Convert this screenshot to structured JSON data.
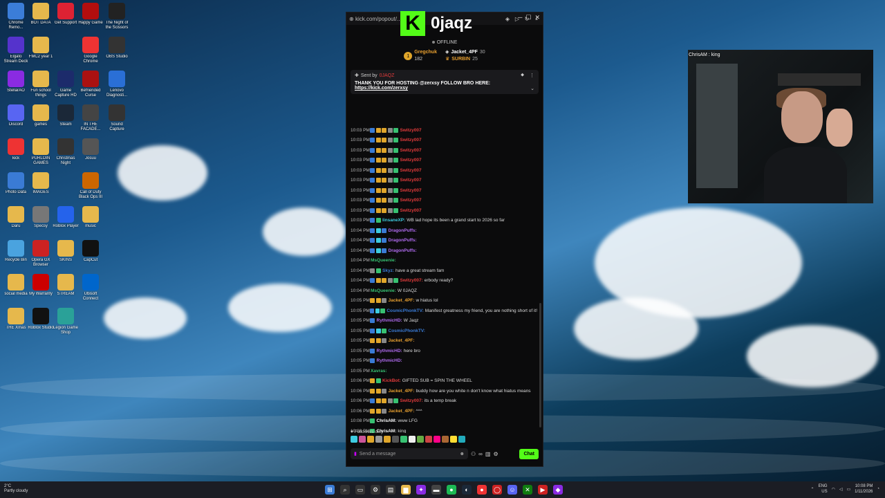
{
  "desktop": {
    "icons": [
      {
        "label": "Chrome Remo...",
        "color": "#3b7dd8"
      },
      {
        "label": "BOT DATA",
        "color": "#e6b84c"
      },
      {
        "label": "Get Support",
        "color": "#d23"
      },
      {
        "label": "Happy Game",
        "color": "#b30e0e"
      },
      {
        "label": "The Night of the Scissors",
        "color": "#222"
      },
      {
        "label": "Elgato Stream Deck",
        "color": "#5533cc"
      },
      {
        "label": "FMC2 year 1",
        "color": "#e6b84c"
      },
      {
        "label": "Google Chrome",
        "color": "#e33"
      },
      {
        "label": "OBS Studio",
        "color": "#333"
      },
      {
        "label": "StellarAO",
        "color": "#8a2be2"
      },
      {
        "label": "Fun school things",
        "color": "#e6b84c"
      },
      {
        "label": "Game Capture HD",
        "color": "#1c2b6b"
      },
      {
        "label": "Befriended Curse",
        "color": "#a11"
      },
      {
        "label": "Lenovo Diagnosti...",
        "color": "#2a6fd6"
      },
      {
        "label": "Discord",
        "color": "#5865f2"
      },
      {
        "label": "games",
        "color": "#e6b84c"
      },
      {
        "label": "Steam",
        "color": "#1b2838"
      },
      {
        "label": "IN THE FACADE...",
        "color": "#444"
      },
      {
        "label": "Sound Capture",
        "color": "#333"
      },
      {
        "label": "kick",
        "color": "#e33"
      },
      {
        "label": "PURLOIN GAMES",
        "color": "#e6b84c"
      },
      {
        "label": "Christmas Night",
        "color": "#333"
      },
      {
        "label": "Josuu",
        "color": "#555"
      },
      {
        "label": "Photo Data",
        "color": "#3a7bd5"
      },
      {
        "label": "IMAGES",
        "color": "#e6b84c"
      },
      {
        "label": "Call of Duty Black Ops III",
        "color": "#c60"
      },
      {
        "label": "Daru",
        "color": "#e6b84c"
      },
      {
        "label": "Specsy",
        "color": "#777"
      },
      {
        "label": "Roblox Player",
        "color": "#2563eb"
      },
      {
        "label": "music",
        "color": "#e6b84c"
      },
      {
        "label": "Recycle Bin",
        "color": "#4aa3df"
      },
      {
        "label": "Opera GX Browser",
        "color": "#c22"
      },
      {
        "label": "SKINS",
        "color": "#e6b84c"
      },
      {
        "label": "CapCut",
        "color": "#111"
      },
      {
        "label": "social media",
        "color": "#e6b84c"
      },
      {
        "label": "My Warranty",
        "color": "#c00"
      },
      {
        "label": "STREAM",
        "color": "#e6b84c"
      },
      {
        "label": "Ubisoft Connect",
        "color": "#0066cc"
      },
      {
        "label": "THE Xmas",
        "color": "#e6b84c"
      },
      {
        "label": "Roblox Studio",
        "color": "#111"
      },
      {
        "label": "Legion Game Shop",
        "color": "#2aa198"
      }
    ]
  },
  "window": {
    "url": "kick.com/popout/...",
    "channel_name": "0jaqz",
    "logo_letter": "K",
    "status": "OFFLINE",
    "leaderboard": [
      {
        "rank": "1",
        "name": "Gregchuk",
        "value": "182"
      },
      {
        "name": "Jacket_4PF",
        "value": "30"
      },
      {
        "name": "SURBIN",
        "value": "25"
      }
    ],
    "pinned": {
      "sent_by_label": "Sent by",
      "sender": "0JAQZ",
      "message": "THANK YOU FOR HOSTING @zerxsy FOLLOW BRO HERE:",
      "link": "https://kick.com/zerxsy"
    },
    "messages": [
      {
        "time": "10:03 PM",
        "user": "Switzy007",
        "color": "#e23b3b",
        "text": "",
        "badges": [
          "#3a7bd5",
          "#e0a62b",
          "#e0a62b",
          "#888",
          "#38c172"
        ]
      },
      {
        "time": "10:03 PM",
        "user": "Switzy007",
        "color": "#e23b3b",
        "text": "",
        "badges": [
          "#3a7bd5",
          "#e0a62b",
          "#e0a62b",
          "#888",
          "#38c172"
        ]
      },
      {
        "time": "10:03 PM",
        "user": "Switzy007",
        "color": "#e23b3b",
        "text": "",
        "badges": [
          "#3a7bd5",
          "#e0a62b",
          "#e0a62b",
          "#888",
          "#38c172"
        ]
      },
      {
        "time": "10:03 PM",
        "user": "Switzy007",
        "color": "#e23b3b",
        "text": "",
        "badges": [
          "#3a7bd5",
          "#e0a62b",
          "#e0a62b",
          "#888",
          "#38c172"
        ]
      },
      {
        "time": "10:03 PM",
        "user": "Switzy007",
        "color": "#e23b3b",
        "text": "",
        "badges": [
          "#3a7bd5",
          "#e0a62b",
          "#e0a62b",
          "#888",
          "#38c172"
        ]
      },
      {
        "time": "10:03 PM",
        "user": "Switzy007",
        "color": "#e23b3b",
        "text": "",
        "badges": [
          "#3a7bd5",
          "#e0a62b",
          "#e0a62b",
          "#888",
          "#38c172"
        ]
      },
      {
        "time": "10:03 PM",
        "user": "Switzy007",
        "color": "#e23b3b",
        "text": "",
        "badges": [
          "#3a7bd5",
          "#e0a62b",
          "#e0a62b",
          "#888",
          "#38c172"
        ]
      },
      {
        "time": "10:03 PM",
        "user": "Switzy007",
        "color": "#e23b3b",
        "text": "",
        "badges": [
          "#3a7bd5",
          "#e0a62b",
          "#e0a62b",
          "#888",
          "#38c172"
        ]
      },
      {
        "time": "10:03 PM",
        "user": "Switzy007",
        "color": "#e23b3b",
        "text": "",
        "badges": [
          "#3a7bd5",
          "#e0a62b",
          "#e0a62b",
          "#888",
          "#38c172"
        ]
      },
      {
        "time": "10:03 PM",
        "user": "linsaneXP:",
        "color": "#3ecbe0",
        "text": "WB lad hope its been a grand start to 2026 so far",
        "badges": [
          "#3a7bd5",
          "#38c172"
        ]
      },
      {
        "time": "10:04 PM",
        "user": "DragonPuffs:",
        "color": "#b06cf0",
        "text": "",
        "badges": [
          "#3a7bd5",
          "#3ecbe0",
          "#3a7bd5"
        ]
      },
      {
        "time": "10:04 PM",
        "user": "DragonPuffs:",
        "color": "#b06cf0",
        "text": "",
        "badges": [
          "#3a7bd5",
          "#3ecbe0",
          "#3a7bd5"
        ]
      },
      {
        "time": "10:04 PM",
        "user": "DragonPuffs:",
        "color": "#b06cf0",
        "text": "",
        "badges": [
          "#3a7bd5",
          "#3ecbe0",
          "#3a7bd5"
        ]
      },
      {
        "time": "10:04 PM",
        "user": "MsQueenie:",
        "color": "#38c172",
        "text": "",
        "badges": []
      },
      {
        "time": "10:04 PM",
        "user": "Skyz:",
        "color": "#3a7bd5",
        "text": "have a great stream fam",
        "badges": [
          "#888",
          "#38c172"
        ]
      },
      {
        "time": "10:04 PM",
        "user": "Switzy007:",
        "color": "#e23b3b",
        "text": "erbody ready?",
        "badges": [
          "#3a7bd5",
          "#e0a62b",
          "#e0a62b",
          "#888",
          "#38c172"
        ]
      },
      {
        "time": "10:04 PM",
        "user": "MsQueenie:",
        "color": "#38c172",
        "text": "W 0JAQZ",
        "badges": []
      },
      {
        "time": "10:05 PM",
        "user": "Jacket_4PF:",
        "color": "#e8a030",
        "text": "w hiatus lol",
        "badges": [
          "#e0a62b",
          "#e0a62b",
          "#888"
        ]
      },
      {
        "time": "10:05 PM",
        "user": "CosmicPhonkTV:",
        "color": "#3a7bd5",
        "text": "Manifest greatness my friend, you are nothing short of it!",
        "badges": [
          "#3a7bd5",
          "#3ecbe0",
          "#38c172"
        ]
      },
      {
        "time": "10:05 PM",
        "user": "RythmicHD:",
        "color": "#b06cf0",
        "text": "W Jaqz",
        "badges": [
          "#3a7bd5"
        ]
      },
      {
        "time": "10:05 PM",
        "user": "CosmicPhonkTV:",
        "color": "#3a7bd5",
        "text": "",
        "badges": [
          "#3a7bd5",
          "#3ecbe0",
          "#38c172"
        ]
      },
      {
        "time": "10:05 PM",
        "user": "Jacket_4PF:",
        "color": "#e8a030",
        "text": "",
        "badges": [
          "#e0a62b",
          "#e0a62b",
          "#888"
        ]
      },
      {
        "time": "10:05 PM",
        "user": "RythmicHD:",
        "color": "#b06cf0",
        "text": "here bro",
        "badges": [
          "#3a7bd5"
        ]
      },
      {
        "time": "10:05 PM",
        "user": "RythmicHD:",
        "color": "#b06cf0",
        "text": "",
        "badges": [
          "#3a7bd5"
        ]
      },
      {
        "time": "10:05 PM",
        "user": "Xavras:",
        "color": "#38c172",
        "text": "",
        "badges": []
      },
      {
        "time": "10:06 PM",
        "user": "KickBot:",
        "color": "#e23b3b",
        "text": "GIFTED SUB = SPIN THE WHEEL",
        "badges": [
          "#e0a62b",
          "#38c172"
        ]
      },
      {
        "time": "10:06 PM",
        "user": "Jacket_4PF:",
        "color": "#e8a030",
        "text": "buddy how are you white n don't know what hiatus means",
        "badges": [
          "#e0a62b",
          "#e0a62b",
          "#888"
        ]
      },
      {
        "time": "10:06 PM",
        "user": "Switzy007:",
        "color": "#e23b3b",
        "text": "its a temp break",
        "badges": [
          "#3a7bd5",
          "#e0a62b",
          "#e0a62b",
          "#888",
          "#38c172"
        ]
      },
      {
        "time": "10:06 PM",
        "user": "Jacket_4PF:",
        "color": "#e8a030",
        "text": "^^^",
        "badges": [
          "#e0a62b",
          "#e0a62b",
          "#888"
        ]
      },
      {
        "time": "10:08 PM",
        "user": "ChrisAM:",
        "color": "#ffffff",
        "text": "www LFG",
        "badges": [
          "#38c172"
        ]
      },
      {
        "time": "10:08 PM",
        "user": "ChrisAM:",
        "color": "#ffffff",
        "text": "king",
        "badges": [
          "#38c172"
        ]
      }
    ],
    "followers_only": "Followers only",
    "emote_colors": [
      "#3ecbe0",
      "#c59",
      "#e0a62b",
      "#999",
      "#e0a62b",
      "#555",
      "#38c172",
      "#eee",
      "#6a4",
      "#c44",
      "#f08",
      "#a63",
      "#fd3",
      "#2ab"
    ],
    "input_placeholder": "Send a message",
    "chat_button": "Chat"
  },
  "webcam": {
    "label": "ChrisAM : king"
  },
  "taskbar": {
    "weather_temp": "2°C",
    "weather_desc": "Partly cloudy",
    "apps": [
      {
        "name": "start",
        "glyph": "⊞",
        "color": "#3a7bd5"
      },
      {
        "name": "search",
        "glyph": "⌕",
        "color": "#333"
      },
      {
        "name": "taskview",
        "glyph": "▭",
        "color": "#333"
      },
      {
        "name": "settings",
        "glyph": "⚙",
        "color": "#333"
      },
      {
        "name": "store",
        "glyph": "▤",
        "color": "#333"
      },
      {
        "name": "files",
        "glyph": "▆",
        "color": "#e6b84c"
      },
      {
        "name": "stellar",
        "glyph": "✦",
        "color": "#8a2be2"
      },
      {
        "name": "terminal",
        "glyph": "▬",
        "color": "#444"
      },
      {
        "name": "spotify",
        "glyph": "●",
        "color": "#1db954"
      },
      {
        "name": "steam",
        "glyph": "◐",
        "color": "#1b2838"
      },
      {
        "name": "chrome",
        "glyph": "●",
        "color": "#e33"
      },
      {
        "name": "opera",
        "glyph": "◯",
        "color": "#c22"
      },
      {
        "name": "discord",
        "glyph": "☺",
        "color": "#5865f2"
      },
      {
        "name": "xbox",
        "glyph": "✕",
        "color": "#107c10"
      },
      {
        "name": "media",
        "glyph": "▶",
        "color": "#c22"
      },
      {
        "name": "twitch",
        "glyph": "◆",
        "color": "#8a2be2"
      }
    ],
    "lang": "ENG",
    "region": "US",
    "time": "10:08 PM",
    "date": "1/11/2026"
  }
}
